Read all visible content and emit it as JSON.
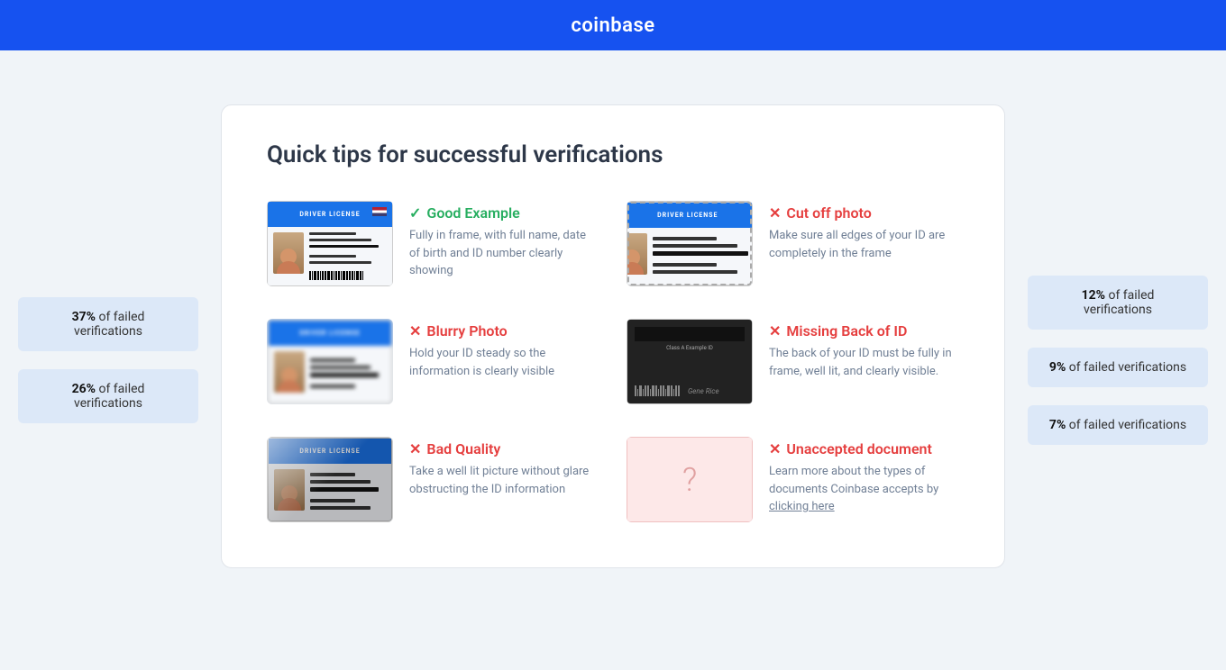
{
  "header": {
    "logo": "coinbase"
  },
  "page": {
    "title": "Quick tips for successful verifications"
  },
  "side_left": {
    "badges": [
      {
        "percent": "37%",
        "label": "of failed verifications"
      },
      {
        "percent": "26%",
        "label": "of failed verifications"
      }
    ]
  },
  "side_right": {
    "badges": [
      {
        "percent": "12%",
        "label": "of failed verifications"
      },
      {
        "percent": "9%",
        "label": "of failed verifications"
      },
      {
        "percent": "7%",
        "label": "of failed verifications"
      }
    ]
  },
  "tips": [
    {
      "id": "good-example",
      "status": "good",
      "title": "Good Example",
      "description": "Fully in frame, with full name, date of birth and ID number clearly showing"
    },
    {
      "id": "cut-off-photo",
      "status": "bad",
      "title": "Cut off photo",
      "description": "Make sure all edges of your ID are completely in the frame"
    },
    {
      "id": "blurry-photo",
      "status": "bad",
      "title": "Blurry Photo",
      "description": "Hold your ID steady so the information is clearly visible"
    },
    {
      "id": "missing-back",
      "status": "bad",
      "title": "Missing Back of ID",
      "description": "The back of your ID must be fully in frame, well lit, and clearly visible."
    },
    {
      "id": "bad-quality",
      "status": "bad",
      "title": "Bad Quality",
      "description": "Take a well lit picture without glare obstructing the ID information"
    },
    {
      "id": "unaccepted-document",
      "status": "bad",
      "title": "Unaccepted document",
      "description": "Learn more about the types of documents Coinbase accepts by",
      "link_text": "clicking here"
    }
  ]
}
